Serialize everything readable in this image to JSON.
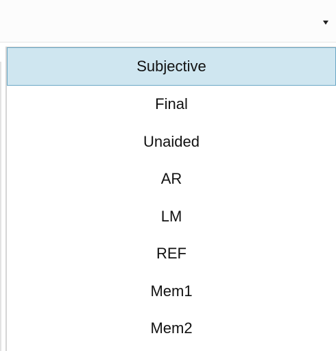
{
  "combo": {
    "value": "",
    "chevron_icon": "chevron-down-icon"
  },
  "dropdown": {
    "options": [
      {
        "label": "Subjective",
        "selected": true
      },
      {
        "label": "Final",
        "selected": false
      },
      {
        "label": "Unaided",
        "selected": false
      },
      {
        "label": "AR",
        "selected": false
      },
      {
        "label": "LM",
        "selected": false
      },
      {
        "label": "REF",
        "selected": false
      },
      {
        "label": "Mem1",
        "selected": false
      },
      {
        "label": "Mem2",
        "selected": false
      }
    ],
    "selected_color": "#cfe6f0",
    "selected_border_color": "#6aa7c5"
  }
}
